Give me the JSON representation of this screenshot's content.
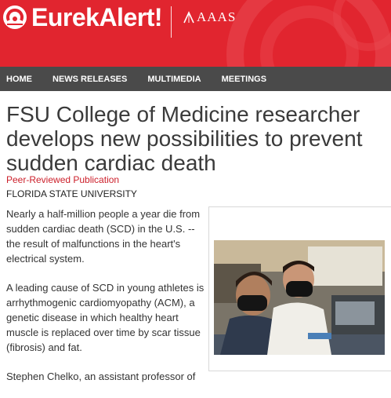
{
  "header": {
    "logo_text": "EurekAlert!",
    "partner_text": "AAAS",
    "bg_color": "#e1252f"
  },
  "nav": {
    "items": [
      "HOME",
      "NEWS RELEASES",
      "MULTIMEDIA",
      "MEETINGS"
    ]
  },
  "article": {
    "title": "FSU College of Medicine researcher develops new possibilities to prevent sudden cardiac death",
    "label": "Peer-Reviewed Publication",
    "institution": "FLORIDA STATE UNIVERSITY",
    "paragraphs": [
      "Nearly a half-million people a year die from sudden cardiac death (SCD) in the U.S. -- the result of malfunctions in the heart's electrical system.",
      "A leading cause of SCD in young athletes is arrhythmogenic cardiomyopathy (ACM), a genetic disease in which healthy heart muscle is replaced over time by scar tissue (fibrosis) and fat.",
      "Stephen Chelko, an assistant professor of"
    ]
  },
  "figure": {
    "image": "photo of two researchers in black face masks working in a laboratory"
  }
}
